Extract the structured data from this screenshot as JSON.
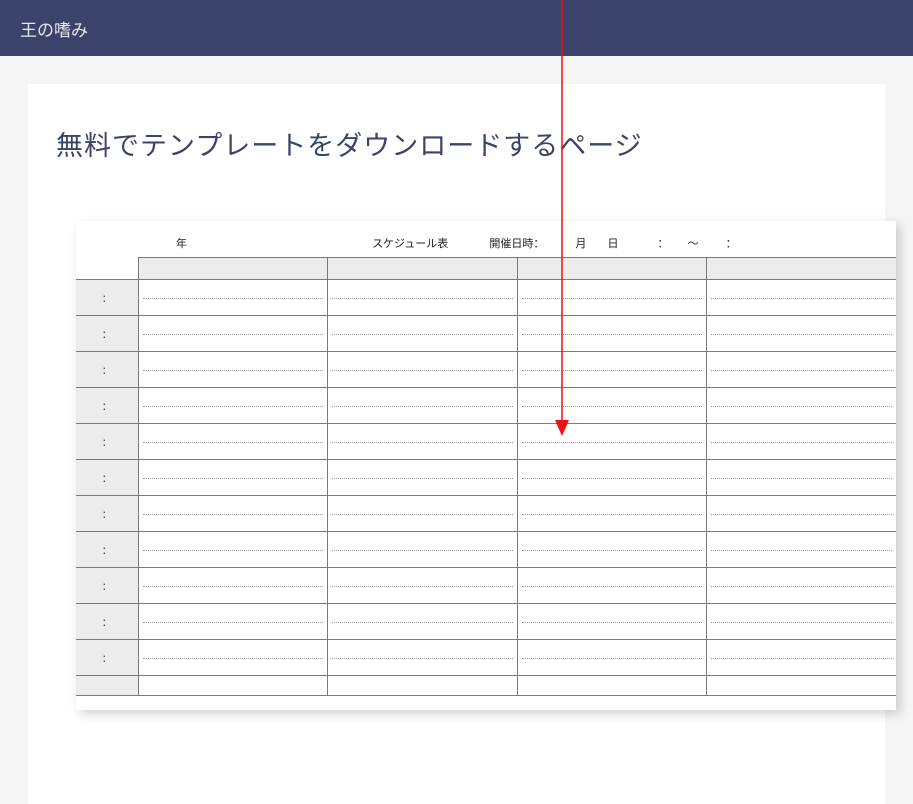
{
  "header": {
    "site_title": "王の嗜み"
  },
  "page": {
    "title": "無料でテンプレートをダウンロードするページ"
  },
  "sheet": {
    "meta": {
      "year_label": "年",
      "title": "スケジュール表",
      "held_label": "開催日時：",
      "month_label": "月",
      "day_label": "日",
      "colon1": "：",
      "tilde": "～",
      "colon2": "："
    },
    "time_rows": [
      "：",
      "：",
      "：",
      "：",
      "：",
      "：",
      "：",
      "：",
      "：",
      "：",
      "："
    ]
  }
}
